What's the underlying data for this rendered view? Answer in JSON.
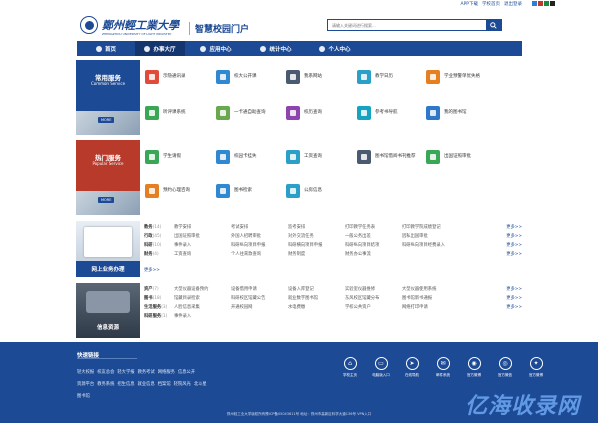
{
  "topbar": {
    "links": [
      "APP下载",
      "学校首页",
      "退出登录"
    ],
    "swatches": [
      "#2a7fd6",
      "#c0392b",
      "#1b8a3e",
      "#222222"
    ]
  },
  "header": {
    "university_cn": "鄭州輕工業大學",
    "university_en": "ZHENGZHOU UNIVERSITY OF LIGHT INDUSTRY",
    "portal": "智慧校园门户",
    "search_placeholder": "请输入关键词进行搜索..."
  },
  "nav": [
    {
      "label": "首页",
      "active": false
    },
    {
      "label": "办事大厅",
      "active": true
    },
    {
      "label": "应用中心",
      "active": false
    },
    {
      "label": "统计中心",
      "active": false
    },
    {
      "label": "个人中心",
      "active": false
    }
  ],
  "common": {
    "title": "常用服务",
    "subtitle": "Common Service",
    "more": "MORE",
    "apps": [
      {
        "label": "示隐通讯录",
        "color": "#e04b3c"
      },
      {
        "label": "校大公开课",
        "color": "#2f88d0"
      },
      {
        "label": "我系网站",
        "color": "#4a5a70"
      },
      {
        "label": "教学日历",
        "color": "#2aa0c8"
      },
      {
        "label": "学业预警单优失格",
        "color": "#e67e22"
      },
      {
        "label": "听评课系统",
        "color": "#3aa757"
      },
      {
        "label": "一卡通自助查询",
        "color": "#6aa84f"
      },
      {
        "label": "校历查询",
        "color": "#8e44ad"
      },
      {
        "label": "参考书导航",
        "color": "#16a3c2"
      },
      {
        "label": "我的图书馆",
        "color": "#2f78c8"
      }
    ]
  },
  "hot": {
    "title": "热门服务",
    "subtitle": "Popular Service",
    "more": "MORE",
    "apps": [
      {
        "label": "学生请假",
        "color": "#3aa757"
      },
      {
        "label": "校园卡挂失",
        "color": "#2f88d0"
      },
      {
        "label": "工资查询",
        "color": "#2aa0c8"
      },
      {
        "label": "图书馆借阅书刊推荐",
        "color": "#4a5a70"
      },
      {
        "label": "出国证照审批",
        "color": "#3aa757"
      },
      {
        "label": "预约心理咨询",
        "color": "#e67e22"
      },
      {
        "label": "图书检索",
        "color": "#2f88d0"
      },
      {
        "label": "公房信息",
        "color": "#2aa0c8"
      }
    ]
  },
  "online": {
    "title": "网上业务办理",
    "rows": [
      {
        "cat": "教务",
        "count": "(14)",
        "items": [
          "教学安排",
          "考试安排",
          "监考安排",
          "打印教学任务表",
          "打印教学院成绩登记"
        ],
        "more": "更多>>"
      },
      {
        "cat": "行政",
        "count": "(45)",
        "items": [
          "出国证照审批",
          "外国人招聘审批",
          "对外交流任务",
          "一般公务出差",
          "因私出国审批"
        ],
        "more": "更多>>"
      },
      {
        "cat": "科研",
        "count": "(10)",
        "items": [
          "事件录入",
          "科研纵向项目申报",
          "科研横向项目申报",
          "科研纵向项目结项",
          "科研纵向项目经费录入"
        ],
        "more": "更多>>"
      },
      {
        "cat": "财务",
        "count": "(4)",
        "items": [
          "工资查询",
          "个人往来款查询",
          "财务制度",
          "财务办公事流",
          ""
        ],
        "more": "更多>>"
      }
    ],
    "more": "更多>>"
  },
  "info": {
    "title": "信息资源",
    "rows": [
      {
        "cat": "资产",
        "count": "(7)",
        "items": [
          "大型仪器设备预约",
          "设备借用申请",
          "设备入库登记",
          "实验室仪器维修",
          "大型仪器使用系统"
        ],
        "more": "更多>>"
      },
      {
        "cat": "图书",
        "count": "(18)",
        "items": [
          "馆藏目录检索",
          "科研校区馆藏公告",
          "就业数字图书馆",
          "东风校区馆藏分布",
          "图书馆新书通报"
        ],
        "more": "更多>>"
      },
      {
        "cat": "生活服务",
        "count": "(3)",
        "items": [
          "人脸信息采集",
          "开通校园网",
          "水电费缴",
          "学校公共资户",
          "网络打印申请"
        ],
        "more": "更多>>"
      },
      {
        "cat": "科研服务",
        "count": "(1)",
        "items": [
          "事件录入",
          "",
          "",
          "",
          ""
        ],
        "more": ""
      }
    ]
  },
  "footer": {
    "heading": "快速链接",
    "links_row1": [
      "轻大校报",
      "校友总会",
      "轻大学报",
      "教务考试",
      "网络服务",
      "信息公开"
    ],
    "links_row2": [
      "资源平台",
      "教务系统",
      "招生信息",
      "就业信息",
      "档案馆",
      "轻院风光",
      "北斗星"
    ],
    "links_row3": [
      "图书馆"
    ],
    "quick": [
      {
        "label": "学校主页",
        "glyph": "⌂"
      },
      {
        "label": "电脑版入口",
        "glyph": "▭"
      },
      {
        "label": "在线导航",
        "glyph": "➤"
      },
      {
        "label": "邮件系统",
        "glyph": "✉"
      },
      {
        "label": "官方微博",
        "glyph": "◉"
      },
      {
        "label": "官方微信",
        "glyph": "◎"
      },
      {
        "label": "官方微博",
        "glyph": "✦"
      }
    ],
    "copyright": "郑州轻工业大学版权所有豫ICP备05043611号 地址：郑州市高新区科学大道136号 VPN入口"
  },
  "watermark": "亿海收录网"
}
